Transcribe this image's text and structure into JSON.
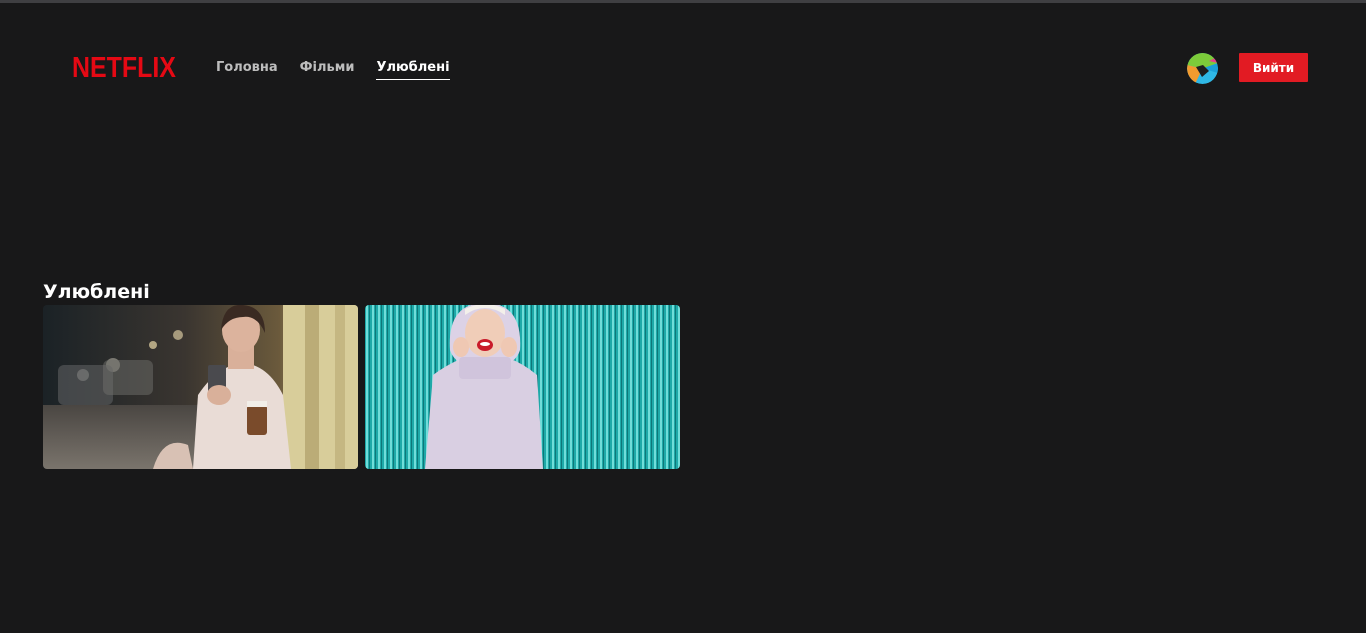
{
  "header": {
    "logo_text": "NETFLIX",
    "nav": [
      {
        "label": "Головна",
        "active": false
      },
      {
        "label": "Фільми",
        "active": false
      },
      {
        "label": "Улюблені",
        "active": true
      }
    ],
    "avatar_icon": "multicolor-avatar-icon",
    "logout_label": "Вийти"
  },
  "favorites": {
    "title": "Улюблені",
    "items": [
      {
        "image": "woman-with-phone-and-coffee-street-night"
      },
      {
        "image": "woman-in-hoodie-laughing-turquoise-tinsel"
      }
    ]
  },
  "colors": {
    "background": "#181819",
    "brand_red": "#e50914",
    "button_red": "#e21b23",
    "nav_inactive": "#bdbdbd"
  }
}
